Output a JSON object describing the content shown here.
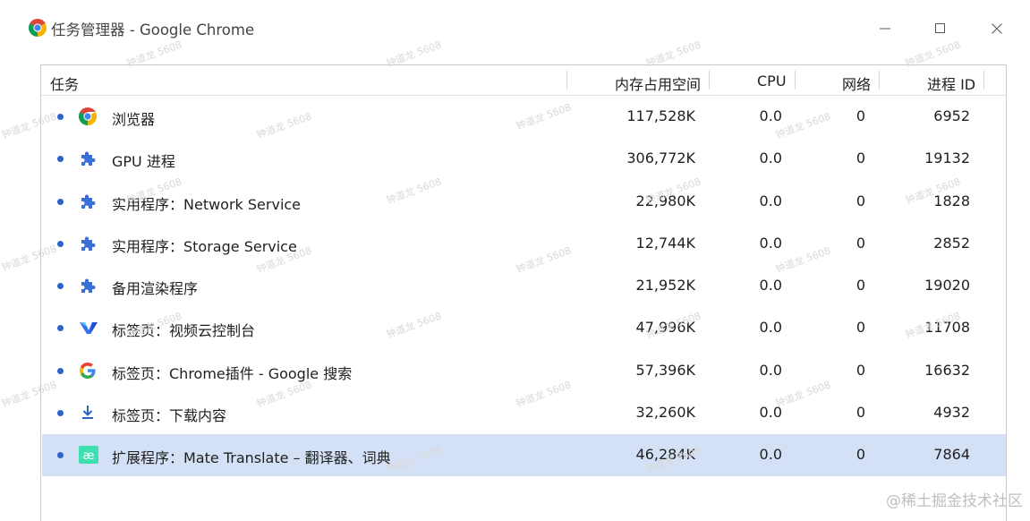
{
  "window": {
    "title": "任务管理器 - Google Chrome",
    "controls": [
      "minimize",
      "maximize",
      "close"
    ]
  },
  "table": {
    "columns": [
      "任务",
      "内存占用空间",
      "CPU",
      "网络",
      "进程 ID"
    ],
    "rows": [
      {
        "icon": "chrome-icon",
        "name": "浏览器",
        "memory": "117,528K",
        "cpu": "0.0",
        "network": "0",
        "pid": "6952",
        "selected": false
      },
      {
        "icon": "puzzle-icon",
        "name": "GPU 进程",
        "memory": "306,772K",
        "cpu": "0.0",
        "network": "0",
        "pid": "19132",
        "selected": false
      },
      {
        "icon": "puzzle-icon",
        "name": "实用程序：Network Service",
        "memory": "22,980K",
        "cpu": "0.0",
        "network": "0",
        "pid": "1828",
        "selected": false
      },
      {
        "icon": "puzzle-icon",
        "name": "实用程序：Storage Service",
        "memory": "12,744K",
        "cpu": "0.0",
        "network": "0",
        "pid": "2852",
        "selected": false
      },
      {
        "icon": "puzzle-icon",
        "name": "备用渲染程序",
        "memory": "21,952K",
        "cpu": "0.0",
        "network": "0",
        "pid": "19020",
        "selected": false
      },
      {
        "icon": "vod-icon",
        "name": "标签页：视频云控制台",
        "memory": "47,996K",
        "cpu": "0.0",
        "network": "0",
        "pid": "11708",
        "selected": false
      },
      {
        "icon": "google-g-icon",
        "name": "标签页：Chrome插件 - Google 搜索",
        "memory": "57,396K",
        "cpu": "0.0",
        "network": "0",
        "pid": "16632",
        "selected": false
      },
      {
        "icon": "download-icon",
        "name": "标签页：下载内容",
        "memory": "32,260K",
        "cpu": "0.0",
        "network": "0",
        "pid": "4932",
        "selected": false
      },
      {
        "icon": "mate-translate-icon",
        "name": "扩展程序：Mate Translate – 翻译器、词典",
        "memory": "46,284K",
        "cpu": "0.0",
        "network": "0",
        "pid": "7864",
        "selected": true
      }
    ]
  },
  "watermark": {
    "text": "钟道龙 5608",
    "corner": "@稀土掘金技术社区"
  },
  "colors": {
    "selected_row": "#d4e0f6",
    "bullet": "#2b63c9",
    "puzzle": "#3b6fd8"
  }
}
